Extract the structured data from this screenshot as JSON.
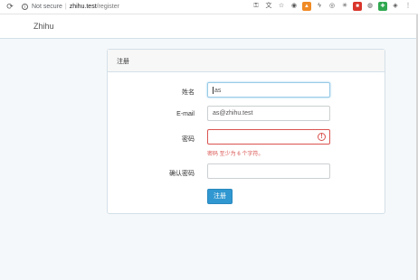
{
  "browser": {
    "reload_icon": "reload-icon",
    "security_text": "Not secure",
    "url_host": "zhihu.test",
    "url_path": "/register",
    "extensions": [
      "key-icon",
      "translate-icon",
      "star-icon"
    ]
  },
  "navbar": {
    "brand": "Zhihu"
  },
  "panel": {
    "heading": "注册",
    "fields": {
      "name": {
        "label": "姓名",
        "value": "as"
      },
      "email": {
        "label": "E-mail",
        "value": "as@zhihu.test"
      },
      "password": {
        "label": "密码",
        "value": "",
        "error": "密码 至少为 6 个字符。"
      },
      "confirm": {
        "label": "确认密码",
        "value": ""
      }
    },
    "submit_label": "注册"
  },
  "colors": {
    "accent": "#3097d1",
    "error": "#d9534f",
    "focus": "#98cbe8"
  }
}
